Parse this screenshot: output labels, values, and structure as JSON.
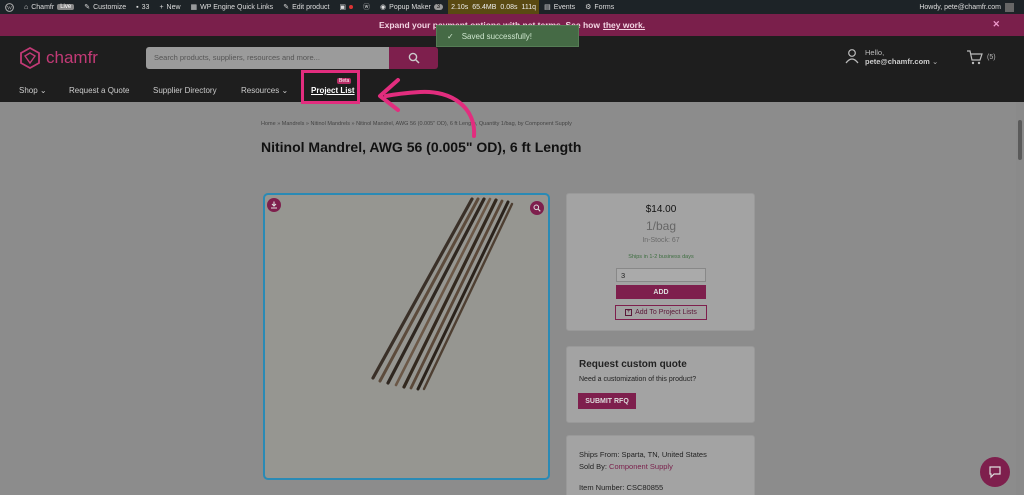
{
  "admin_bar": {
    "site": "Chamfr",
    "live": "Live",
    "customize": "Customize",
    "comments": "33",
    "new": "New",
    "quick_links": "WP Engine Quick Links",
    "edit_product": "Edit product",
    "popup_maker": "Popup Maker",
    "popup_count": "3",
    "perf": [
      "2.10s",
      "65.4MB",
      "0.08s",
      "111q"
    ],
    "events": "Events",
    "forms": "Forms",
    "howdy": "Howdy, pete@chamfr.com"
  },
  "promo": {
    "text": "Expand your payment options with net terms. See how",
    "link": "they work."
  },
  "toast": {
    "icon": "check-icon",
    "check": "✓",
    "message": "Saved successfully!"
  },
  "header": {
    "logo": "chamfr",
    "search_placeholder": "Search products, suppliers, resources and more...",
    "hello": "Hello,",
    "user": "pete@chamfr.com",
    "cart_count": "(5)"
  },
  "nav": {
    "shop": "Shop",
    "request_quote": "Request a Quote",
    "supplier_directory": "Supplier Directory",
    "resources": "Resources",
    "project_list": "Project List",
    "beta": "Beta"
  },
  "product": {
    "breadcrumb": "Home » Mandrels » Nitinol Mandrels » Nitinol Mandrel, AWG 56 (0.005\" OD), 6 ft Length, Quantity 1/bag, by Component Supply",
    "title": "Nitinol Mandrel, AWG 56 (0.005\" OD), 6 ft Length",
    "price": "$14.00",
    "unit": "1/bag",
    "stock": "In-Stock: 67",
    "ships_note": "Ships in 1-2 business days",
    "quantity": "3",
    "add_label": "ADD",
    "project_list_label": "Add To Project Lists"
  },
  "quote": {
    "title": "Request custom quote",
    "subtitle": "Need a customization of this product?",
    "button": "SUBMIT RFQ"
  },
  "info": {
    "ships_from_label": "Ships From:",
    "ships_from": "Sparta, TN, United States",
    "sold_by_label": "Sold By:",
    "sold_by": "Component Supply",
    "item_number_label": "Item Number:",
    "item_number": "CSC80855"
  },
  "colors": {
    "brand": "#c2185b",
    "highlight": "#e91e7e",
    "admin_bar": "#1d2327"
  }
}
